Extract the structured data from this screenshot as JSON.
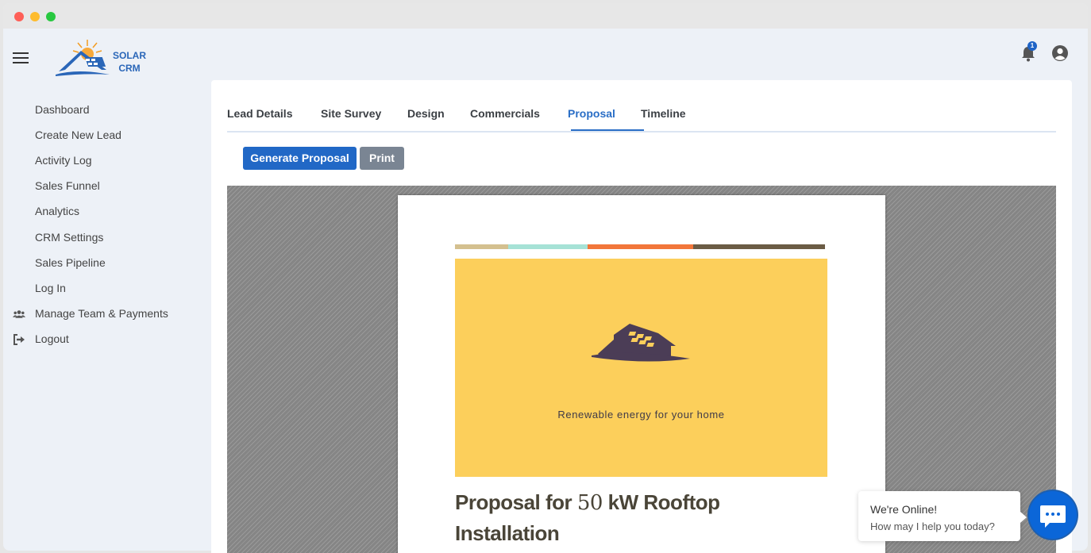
{
  "app": {
    "logo_line1": "SOLAR",
    "logo_line2": "CRM",
    "notification_count": "1"
  },
  "sidebar": {
    "items": [
      {
        "label": "Dashboard"
      },
      {
        "label": "Create New Lead"
      },
      {
        "label": "Activity Log"
      },
      {
        "label": "Sales Funnel"
      },
      {
        "label": "Analytics"
      },
      {
        "label": "CRM Settings"
      },
      {
        "label": "Sales Pipeline"
      },
      {
        "label": "Log In"
      },
      {
        "label": "Manage Team & Payments",
        "icon": "users-icon"
      },
      {
        "label": "Logout",
        "icon": "sign-out-icon"
      }
    ]
  },
  "tabs": [
    {
      "label": "Lead Details"
    },
    {
      "label": "Site Survey"
    },
    {
      "label": "Design"
    },
    {
      "label": "Commercials"
    },
    {
      "label": "Proposal",
      "active": true
    },
    {
      "label": "Timeline"
    }
  ],
  "actions": {
    "generate_label": "Generate Proposal",
    "print_label": "Print"
  },
  "document": {
    "tagline": "Renewable energy for your home",
    "title_prefix": "Proposal for ",
    "title_number": "50",
    "title_suffix": " kW Rooftop",
    "title_line2": "Installation",
    "stripe_colors": [
      "#d4c08f",
      "#a6e2d6",
      "#f2763a",
      "#6b5c45"
    ],
    "hero_color": "#fccf5b"
  },
  "chat": {
    "line1": "We're Online!",
    "line2": "How may I help you today?"
  },
  "colors": {
    "accent": "#2a6ec6",
    "primary_button": "#2168c6",
    "secondary_button": "#7a8593"
  }
}
